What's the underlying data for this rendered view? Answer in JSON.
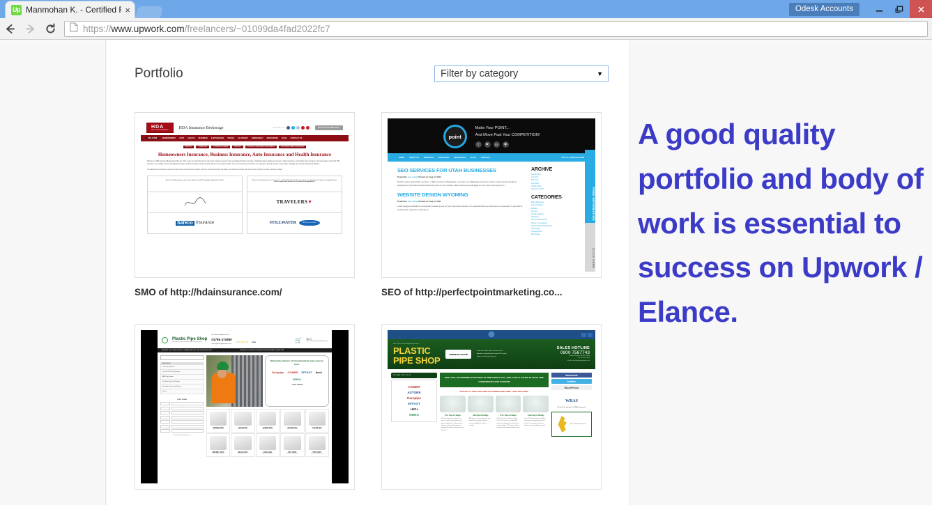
{
  "browser": {
    "tab": {
      "title": "Manmohan K. - Certified F",
      "favicon_text": "Up",
      "favicon_name": "upwork-favicon",
      "close_label": "×"
    },
    "new_tab_label": "",
    "account_button": "Odesk Accounts",
    "window_controls": {
      "minimize": "minimize-icon",
      "restore": "restore-icon",
      "close": "close-icon"
    },
    "nav": {
      "back": "back-arrow-icon",
      "forward": "forward-arrow-icon",
      "reload": "reload-icon"
    },
    "url": {
      "scheme": "https://",
      "host": "www.upwork.com",
      "path": "/freelancers/~01099da4fad2022fc7",
      "full": "https://www.upwork.com/freelancers/~01099da4fad2022fc7"
    }
  },
  "page": {
    "section_title": "Portfolio",
    "filter": {
      "label": "Filter by category",
      "caret": "▾"
    },
    "items": [
      {
        "caption": "SMO of http://hdainsurance.com/"
      },
      {
        "caption": "SEO of http://perfectpointmarketing.co..."
      },
      {
        "caption": ""
      },
      {
        "caption": ""
      }
    ]
  },
  "overlay": {
    "text": "A good quality portfolio and body of work is essential to success on Upwork / Elance.",
    "color": "#3b3bc8"
  },
  "thumb1": {
    "logo": "HDA",
    "logo_sub": "MULTI LINES INSURANCE",
    "brand": "HDA Insurance Brokerage",
    "connect_label": "Connect with us on:",
    "cta": "REAL ESTATE DIRECTORY",
    "nav": [
      "WELCOME",
      "HOMEOWNERS",
      "AUTO",
      "HEALTH",
      "BUSINESS",
      "EARTHQUAKE",
      "TRAVEL",
      "GLOSSARY",
      "EMERGENCY",
      "RESOURCES",
      "BLOG",
      "CONTACT US"
    ],
    "pills": [
      "AVIATION",
      "COMMERCIAL",
      "FOREIGN EXCHANGE",
      "WELDING",
      "WORKERS COMPENSATION INSURANCE",
      "WORLDWIDE HEALTH INSURANCE"
    ],
    "headline": "Homeowners Insurance, Business Insurance, Auto Insurance and Health Insurance",
    "para1": "Welcome to HDA Insurance Brokerage's Web site. This is your one stop Web site for all of your insurance needs. If you are looking for Home Insurance, Health Insurance, Business Insurance, Travel Insurance, or Specialty Lines Insurance, this is the place to find it all! HDA Insurance is a certified and licensed National provider of Home Insurance products online direct to the consumer public. Our success has been fueled by our impressive national network of real estate, mortgage and escrow professional affiliates.",
    "para2": "As independent processors, we are not tied to just one insurance company. We act in your best interest. We place your insurance directly with some of this country's premier insurance carriers.",
    "box_left": "Received a Homeowners Insurance Quote by mail? Complete application below!",
    "box_right": "Please note: Homeowners Insurance is specifically underwritten for owner occupied homes! Tenant occupied homes will be quoted and written as a Landlord Package policy!",
    "carrier1": "TRAVELERS",
    "carrier2": "Safeco Insurance",
    "carrier3": "STILLWATER",
    "badge": "GET A QUOTE NOW!"
  },
  "thumb2": {
    "logo": "point",
    "tagline1": "Make Your POINT...",
    "tagline2": "And Move Past Your COMPETITION!",
    "social": [
      "f",
      "▶",
      "in",
      "ⓟ"
    ],
    "nav": [
      "HOME",
      "ABOUT US",
      "SERVICES",
      "PORTFOLIO",
      "RESOURCES",
      "BLOG",
      "CONTACT"
    ],
    "phone": "Call Us: (208) 643-0768",
    "post1_title": "SEO SERVICES FOR UTAH BUSINESSES",
    "post1_meta_a": "Posted by:",
    "post1_author": "seo_tools",
    "post1_meta_b": "| Posted on: Aug 11, 2014",
    "post1_text": "Search engine optimization services, or SEO services in Washington, can help your Washington business perform well in search results by targeting the right audiences and delivering them to your website. SEO services as a package is much more than keyword [...]",
    "post2_title": "WEBSITE DESIGN WYOMING",
    "post2_text": "A well designed website is an important marketing tool for your Wyoming business. It is essential that your business be presented in a way that is professional, organized, and easy to",
    "archive_title": "ARCHIVE",
    "archive": [
      "August 2014",
      "July 2014",
      "May 2014",
      "April 2014",
      "October 2013",
      "September 2013"
    ],
    "categories_title": "CATEGORIES",
    "categories": [
      "Brand Awareness",
      "Custom Apparel",
      "E-Books",
      "General",
      "Google Analytics",
      "Marketing",
      "Promotional Products",
      "Return on Investment",
      "Search Engine Optimization",
      "Technology",
      "Uncategorized",
      "Web Design"
    ],
    "side_tab": "FREE INFORMATION",
    "side_tab2": "CLICK HERE"
  },
  "thumb3": {
    "brand": "Plastic Pipe Shop",
    "brand_sub": "Nationwide suppliers of industrial plastic pipe systems",
    "sales_label": "For Sales and Advice Call",
    "phone": "01786 472850",
    "email": "sales@plasticpipeshop.co.uk",
    "stars": "★★★★★",
    "feefo": "feefo",
    "cart": "🛒",
    "cart_items": "Items: 0",
    "cart_value": "Value: £0",
    "cart_links": "View Cart | Checkout | My Account",
    "bar_left": "DELIVERY: £9.99, FREE OVER £50, GUARANTEED NEXT DAY 01786 472850 INFO",
    "bar_right": "ORDER IN OUR SECURE ONLINE STORE OR BY EMAIL / PHONE / FAX",
    "search_placeholder": "Enter Part No",
    "cat_title": "CATEGORIES",
    "categories": [
      "PVC Pipe Systems",
      "Corzan CPVC Pipe Systems",
      "ABS Pipe System",
      "Ventilation Pipe and Fittings",
      "Industrial Suction and Delivery",
      "Rooms"
    ],
    "quick_order": "QUICK ORDER",
    "quick_cols": [
      "QTY",
      "Marid / Model/Part#"
    ],
    "quick_link": "Click here to add more items >>",
    "promo_title": "Nationwide delivery of industrial plastic pipe systems from:",
    "promo_brands": [
      "Durapipe",
      "COMER",
      "EFFAST",
      "beck",
      "HOKA"
    ],
    "promo_more": "...and others",
    "products": [
      {
        "name": "METRIC PVC",
        "sub": "Pipe, Fittings & Valves"
      },
      {
        "name": "INCH PVC",
        "sub": "Pipe, Fittings & Valves"
      },
      {
        "name": "SCH80 PVC",
        "sub": "Pipe, Fittings & Valves"
      },
      {
        "name": "SCH40 PVC",
        "sub": "Pipe, Fittings & Valves"
      },
      {
        "name": "CLEAR PVC",
        "sub": "Pipe & Fittings"
      },
      {
        "name": "METRIC CPVC",
        "sub": "Pipe, Fittings & Valves"
      },
      {
        "name": "INCH CPVC",
        "sub": "Pipe, Fittings & Valves"
      },
      {
        "name": "INCH ABS",
        "sub": "Pipe, Fittings & Valves"
      },
      {
        "name": "PVC VENT",
        "sub": "Pipe, Fittings & Dampers"
      },
      {
        "name": "PPS VENT",
        "sub": "Pipe, Fittings & Dampers"
      }
    ]
  },
  "thumb4": {
    "part_of": "Part of The Pisces Engineering Group",
    "logo_line1": "PLASTIC",
    "logo_line2": "PIPE SHOP",
    "amazon": "amazon.co.uk",
    "amazon_voucher": "£10",
    "amazon_text": "Order over £300 online and recieve an Amazon.co.uk gift voucher worth 5% of your order as a thank you from us!",
    "hotline_label": "SALES HOTLINE",
    "hotline_number": "0800 7567743",
    "general": "General enquiries: 01786 472850",
    "fax": "Fax: 01786 473905",
    "email": "Email: sales@plasticpipeshop.co.uk",
    "left_header": "PVC, ABS, CPVC, PP, PE",
    "brands": [
      "COMER",
      "ASTORE",
      "Durapipe",
      "EFFAST",
      "+GF+",
      "HOKA"
    ],
    "banner": "NEXT DAY, NATIONWIDE SUPPLIERS OF INDUSTRIAL PVC, ABS, CPVC & OTHER PLASTIC PIPE COMPONENTS AND SYSTEMS",
    "offer": "£9.99 UP TO 10KG AND OVER £50 ORDERS ARE FREE! ..PIPE INCLUDED*",
    "products": [
      {
        "name": "PVC Pipe & Fittings",
        "text": "PVC pipe sometimes called uvc or upvc is a plastic pipe ideal for most general applications. With good anti-abrasion and strength, pvc pipe is designed to operate at between 0 and 60 deg C"
      },
      {
        "name": "ABS Pipe & Fittings",
        "text": "ABS pipe is a very tough plastic pipe material with excellent abrasion resistance. ABS pipe is able to maintain"
      },
      {
        "name": "cPVC Pipe & Fittings",
        "text": "CPVC pipe also sometimes called PVC-C or Corzan is a modified PVC plastic pipe designed to cope with hot, corrosive liquids. CPVC pipe is able to withstand temperatures between 0 and"
      },
      {
        "name": "Clear Pipe & Fittings",
        "text": "Clear PVC plastic pipe is available in both metric and imperial pipe sizes, but with the exception of sockets, fittings are only available in imperial"
      }
    ],
    "social": [
      "facebook",
      "twitter",
      "WordPress"
    ],
    "wras": "WRAS",
    "wras_text": "All our PVC pipework is WRAS approved!",
    "map_text": "UK wide distribution centres"
  }
}
